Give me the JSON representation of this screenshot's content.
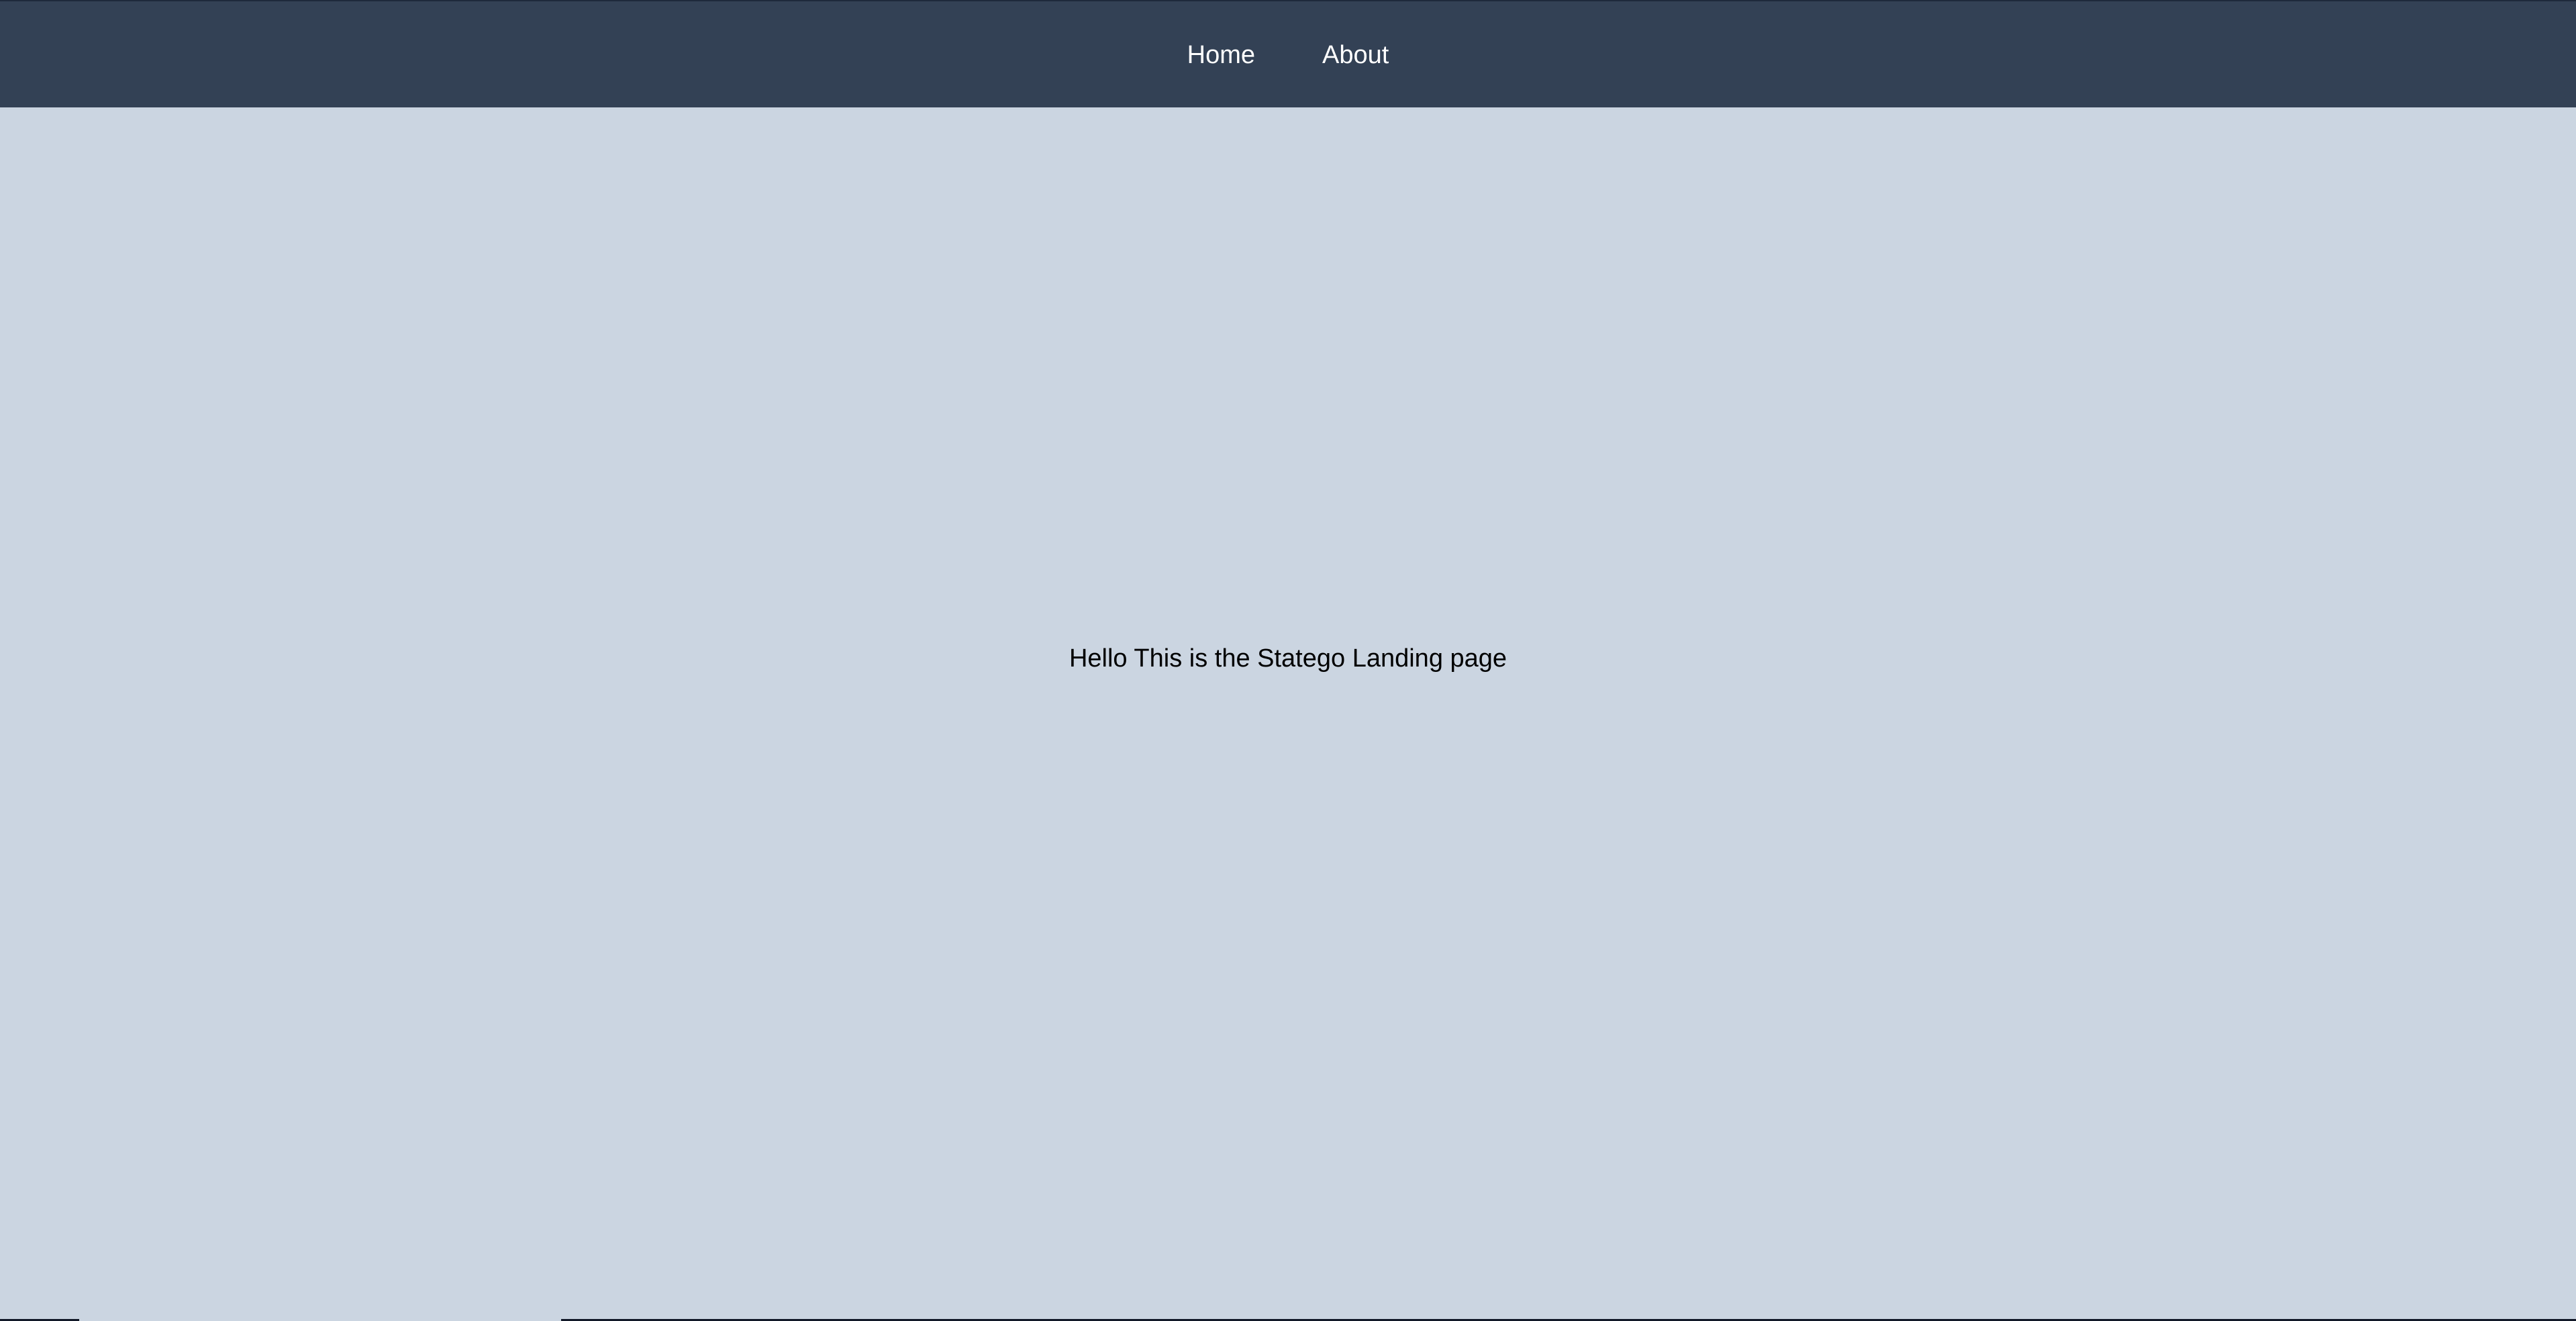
{
  "nav": {
    "home_label": "Home",
    "about_label": "About"
  },
  "main": {
    "landing_text": "Hello This is the Statego Landing page"
  },
  "colors": {
    "navbar_bg": "#334155",
    "page_bg": "#cbd5e1",
    "nav_text": "#ffffff",
    "body_text": "#000000"
  }
}
